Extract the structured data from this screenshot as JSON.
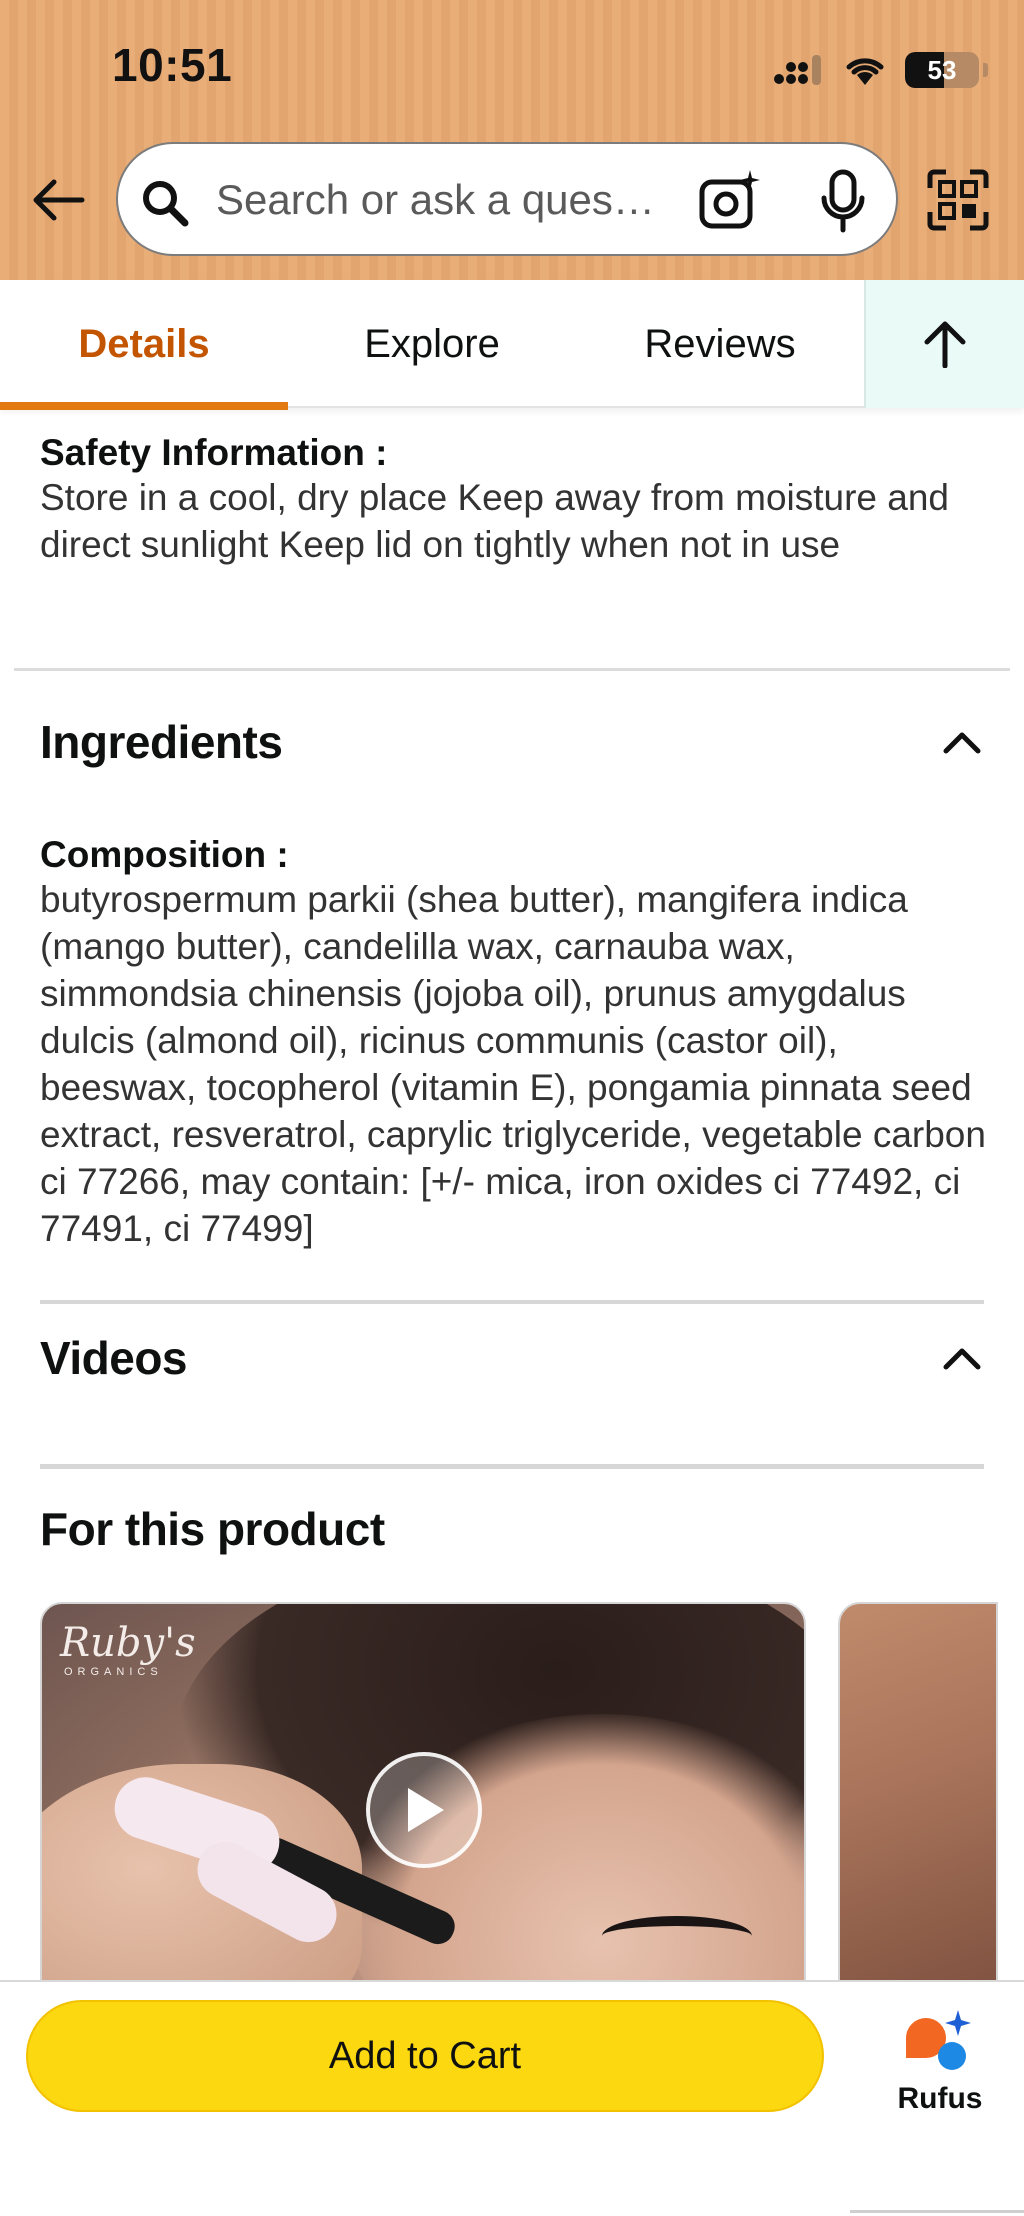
{
  "status_bar": {
    "time": "10:51",
    "battery": "53",
    "battery_level_percent": 53
  },
  "search": {
    "placeholder": "Search or ask a ques…"
  },
  "icons": {
    "back": "back-arrow-icon",
    "search": "search-icon",
    "camera": "camera-sparkle-icon",
    "mic": "mic-icon",
    "qr": "qr-scan-icon",
    "up": "arrow-up-icon",
    "chevron": "chevron-up-icon",
    "play": "play-icon",
    "rufus": "rufus-icon"
  },
  "tabs": [
    {
      "label": "Details",
      "active": true
    },
    {
      "label": "Explore",
      "active": false
    },
    {
      "label": "Reviews",
      "active": false
    }
  ],
  "safety": {
    "label": "Safety Information :",
    "text": "Store in a cool, dry place Keep away from moisture and direct sunlight Keep lid on tightly when not in use"
  },
  "ingredients": {
    "title": "Ingredients",
    "composition_label": "Composition :",
    "composition_text": "butyrospermum parkii (shea butter), mangifera indica (mango butter), candelilla wax, carnauba wax, simmondsia chinensis (jojoba oil), prunus amygdalus dulcis (almond oil), ricinus communis (castor oil), beeswax, tocopherol (vitamin E), pongamia pinnata seed extract, resveratrol, caprylic triglyceride, vegetable carbon ci 77266, may contain: [+/- mica, iron oxides ci 77492, ci 77491, ci 77499]"
  },
  "videos": {
    "title": "Videos",
    "subtitle": "For this product",
    "brand_logo": "Ruby's",
    "brand_sub": "ORGANICS"
  },
  "bottom": {
    "add_to_cart": "Add to Cart",
    "rufus": "Rufus"
  },
  "colors": {
    "header": "#e9ad78",
    "accent": "#e47911",
    "cart_button": "#fcd810"
  }
}
